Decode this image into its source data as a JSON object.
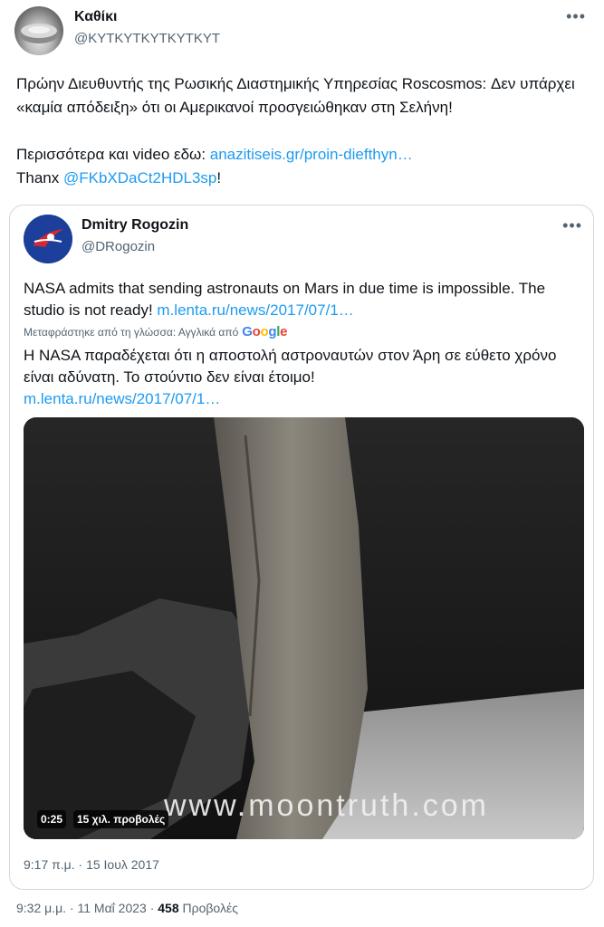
{
  "author": {
    "name": "Καθίκι",
    "handle": "@ΚΥΤΚΥΤΚΥΤΚΥΤΚΥΤ"
  },
  "tweet": {
    "line1": "Πρώην Διευθυντής της Ρωσικής Διαστημικής Υπηρεσίας Roscosmos: Δεν υπάρχει «καμία απόδειξη» ότι οι Αμερικανοί προσγειώθηκαν στη Σελήνη!",
    "more_prefix": "Περισσότερα και video εδω: ",
    "more_link": "anazitiseis.gr/proin-diefthyn…",
    "thanx_prefix": "Thanx ",
    "thanx_mention": "@FKbXDaCt2HDL3sp",
    "thanx_suffix": "!"
  },
  "quoted": {
    "name": "Dmitry Rogozin",
    "handle": "@DRogozin",
    "text": "NASA admits that sending astronauts on Mars in due time is impossible. The studio is not ready! ",
    "link": "m.lenta.ru/news/2017/07/1…",
    "translated_label": "Μεταφράστηκε από τη γλώσσα: Αγγλικά από",
    "translation": "Η NASA παραδέχεται ότι η αποστολή αστροναυτών στον Άρη σε εύθετο χρόνο είναι αδύνατη. Το στούντιο δεν είναι έτοιμο!",
    "translation_link": "m.lenta.ru/news/2017/07/1…",
    "video": {
      "duration": "0:25",
      "views": "15 χιλ. προβολές",
      "watermark": "www.moontruth.com"
    },
    "date": "9:17 π.μ. · 15 Ιουλ 2017"
  },
  "meta": {
    "time": "9:32 μ.μ. · 11 Μαΐ 2023 · ",
    "views_count": "458",
    "views_label": " Προβολές"
  },
  "icons": {
    "more": "more-horizontal-icon"
  }
}
